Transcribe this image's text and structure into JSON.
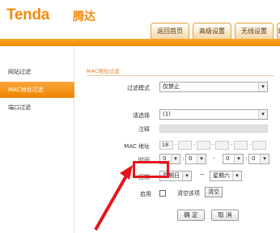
{
  "header": {
    "logo": "Tenda",
    "logo_cn": "腾达"
  },
  "tabs": [
    {
      "label": "返回首页"
    },
    {
      "label": "高级设置"
    },
    {
      "label": "无线设置"
    },
    {
      "label": "D"
    }
  ],
  "sidebar": {
    "items": [
      {
        "label": "网站过滤",
        "active": false
      },
      {
        "label": "MAC地址过滤",
        "active": true
      },
      {
        "label": "端口过滤",
        "active": false
      }
    ]
  },
  "form": {
    "title": "MAC地址过滤",
    "filter_mode": {
      "label": "过滤模式",
      "value": "仅禁止"
    },
    "choose": {
      "label": "请选择",
      "value": "(1)"
    },
    "note": {
      "label": "注释"
    },
    "mac": {
      "label": "MAC 地址",
      "first": "18",
      "separators": [
        "·",
        "·",
        "·",
        "·",
        "·"
      ]
    },
    "time": {
      "label": "时间",
      "start_h": "0",
      "start_m": "0",
      "sep": "-",
      "end_h": "0",
      "end_m": "0",
      "colon": ":"
    },
    "date": {
      "label": "日期",
      "from": "星期日",
      "sep": "~",
      "to": "星期六"
    },
    "enable": {
      "label": "启用",
      "checked": false
    },
    "clear": {
      "label": "清空该项",
      "button": "清空"
    }
  },
  "buttons": {
    "ok": "确 定",
    "cancel": "取 消"
  },
  "colors": {
    "brand": "#f28a0c",
    "highlight": "#e8141b"
  }
}
